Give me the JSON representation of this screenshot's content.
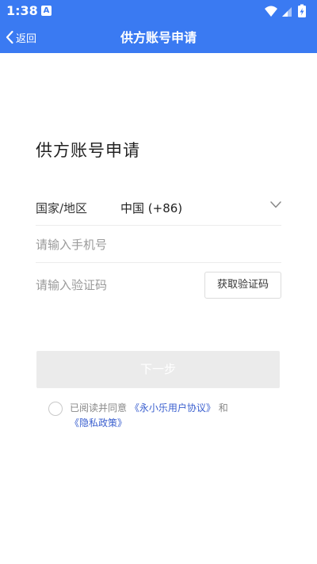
{
  "status_bar": {
    "time": "1:38",
    "notification_badge": "A",
    "accent": "#3a7af2"
  },
  "nav": {
    "back_label": "返回",
    "title": "供方账号申请"
  },
  "form": {
    "heading": "供方账号申请",
    "country_label": "国家/地区",
    "country_value": "中国 (+86)",
    "phone_placeholder": "请输入手机号",
    "phone_value": "",
    "code_placeholder": "请输入验证码",
    "code_value": "",
    "get_code_label": "获取验证码",
    "next_label": "下一步"
  },
  "agreement": {
    "prefix": "已阅读并同意",
    "user_agreement": "《永小乐用户协议》",
    "conjunction": "和",
    "privacy_policy": "《隐私政策》",
    "checked": false
  }
}
